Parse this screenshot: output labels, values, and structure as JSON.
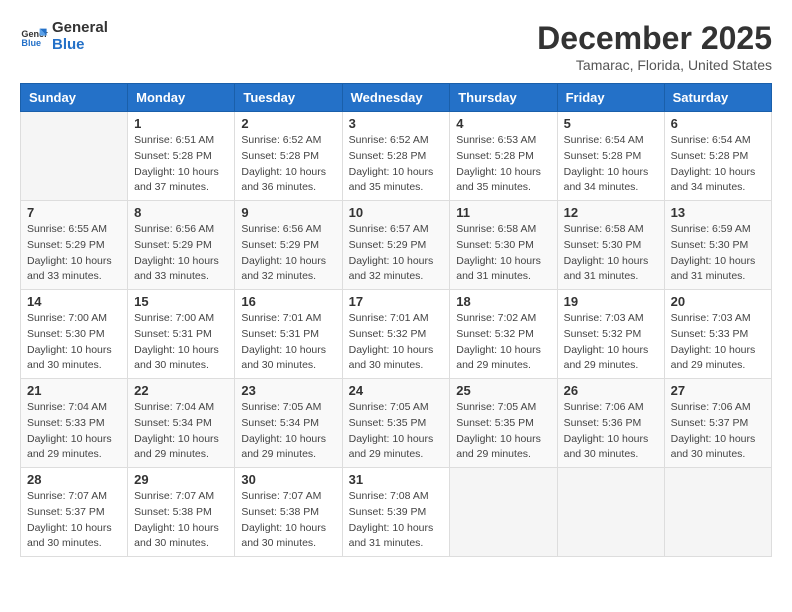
{
  "logo": {
    "line1": "General",
    "line2": "Blue"
  },
  "title": "December 2025",
  "location": "Tamarac, Florida, United States",
  "days_of_week": [
    "Sunday",
    "Monday",
    "Tuesday",
    "Wednesday",
    "Thursday",
    "Friday",
    "Saturday"
  ],
  "weeks": [
    [
      {
        "day": "",
        "info": ""
      },
      {
        "day": "1",
        "info": "Sunrise: 6:51 AM\nSunset: 5:28 PM\nDaylight: 10 hours\nand 37 minutes."
      },
      {
        "day": "2",
        "info": "Sunrise: 6:52 AM\nSunset: 5:28 PM\nDaylight: 10 hours\nand 36 minutes."
      },
      {
        "day": "3",
        "info": "Sunrise: 6:52 AM\nSunset: 5:28 PM\nDaylight: 10 hours\nand 35 minutes."
      },
      {
        "day": "4",
        "info": "Sunrise: 6:53 AM\nSunset: 5:28 PM\nDaylight: 10 hours\nand 35 minutes."
      },
      {
        "day": "5",
        "info": "Sunrise: 6:54 AM\nSunset: 5:28 PM\nDaylight: 10 hours\nand 34 minutes."
      },
      {
        "day": "6",
        "info": "Sunrise: 6:54 AM\nSunset: 5:28 PM\nDaylight: 10 hours\nand 34 minutes."
      }
    ],
    [
      {
        "day": "7",
        "info": "Sunrise: 6:55 AM\nSunset: 5:29 PM\nDaylight: 10 hours\nand 33 minutes."
      },
      {
        "day": "8",
        "info": "Sunrise: 6:56 AM\nSunset: 5:29 PM\nDaylight: 10 hours\nand 33 minutes."
      },
      {
        "day": "9",
        "info": "Sunrise: 6:56 AM\nSunset: 5:29 PM\nDaylight: 10 hours\nand 32 minutes."
      },
      {
        "day": "10",
        "info": "Sunrise: 6:57 AM\nSunset: 5:29 PM\nDaylight: 10 hours\nand 32 minutes."
      },
      {
        "day": "11",
        "info": "Sunrise: 6:58 AM\nSunset: 5:30 PM\nDaylight: 10 hours\nand 31 minutes."
      },
      {
        "day": "12",
        "info": "Sunrise: 6:58 AM\nSunset: 5:30 PM\nDaylight: 10 hours\nand 31 minutes."
      },
      {
        "day": "13",
        "info": "Sunrise: 6:59 AM\nSunset: 5:30 PM\nDaylight: 10 hours\nand 31 minutes."
      }
    ],
    [
      {
        "day": "14",
        "info": "Sunrise: 7:00 AM\nSunset: 5:30 PM\nDaylight: 10 hours\nand 30 minutes."
      },
      {
        "day": "15",
        "info": "Sunrise: 7:00 AM\nSunset: 5:31 PM\nDaylight: 10 hours\nand 30 minutes."
      },
      {
        "day": "16",
        "info": "Sunrise: 7:01 AM\nSunset: 5:31 PM\nDaylight: 10 hours\nand 30 minutes."
      },
      {
        "day": "17",
        "info": "Sunrise: 7:01 AM\nSunset: 5:32 PM\nDaylight: 10 hours\nand 30 minutes."
      },
      {
        "day": "18",
        "info": "Sunrise: 7:02 AM\nSunset: 5:32 PM\nDaylight: 10 hours\nand 29 minutes."
      },
      {
        "day": "19",
        "info": "Sunrise: 7:03 AM\nSunset: 5:32 PM\nDaylight: 10 hours\nand 29 minutes."
      },
      {
        "day": "20",
        "info": "Sunrise: 7:03 AM\nSunset: 5:33 PM\nDaylight: 10 hours\nand 29 minutes."
      }
    ],
    [
      {
        "day": "21",
        "info": "Sunrise: 7:04 AM\nSunset: 5:33 PM\nDaylight: 10 hours\nand 29 minutes."
      },
      {
        "day": "22",
        "info": "Sunrise: 7:04 AM\nSunset: 5:34 PM\nDaylight: 10 hours\nand 29 minutes."
      },
      {
        "day": "23",
        "info": "Sunrise: 7:05 AM\nSunset: 5:34 PM\nDaylight: 10 hours\nand 29 minutes."
      },
      {
        "day": "24",
        "info": "Sunrise: 7:05 AM\nSunset: 5:35 PM\nDaylight: 10 hours\nand 29 minutes."
      },
      {
        "day": "25",
        "info": "Sunrise: 7:05 AM\nSunset: 5:35 PM\nDaylight: 10 hours\nand 29 minutes."
      },
      {
        "day": "26",
        "info": "Sunrise: 7:06 AM\nSunset: 5:36 PM\nDaylight: 10 hours\nand 30 minutes."
      },
      {
        "day": "27",
        "info": "Sunrise: 7:06 AM\nSunset: 5:37 PM\nDaylight: 10 hours\nand 30 minutes."
      }
    ],
    [
      {
        "day": "28",
        "info": "Sunrise: 7:07 AM\nSunset: 5:37 PM\nDaylight: 10 hours\nand 30 minutes."
      },
      {
        "day": "29",
        "info": "Sunrise: 7:07 AM\nSunset: 5:38 PM\nDaylight: 10 hours\nand 30 minutes."
      },
      {
        "day": "30",
        "info": "Sunrise: 7:07 AM\nSunset: 5:38 PM\nDaylight: 10 hours\nand 30 minutes."
      },
      {
        "day": "31",
        "info": "Sunrise: 7:08 AM\nSunset: 5:39 PM\nDaylight: 10 hours\nand 31 minutes."
      },
      {
        "day": "",
        "info": ""
      },
      {
        "day": "",
        "info": ""
      },
      {
        "day": "",
        "info": ""
      }
    ]
  ]
}
